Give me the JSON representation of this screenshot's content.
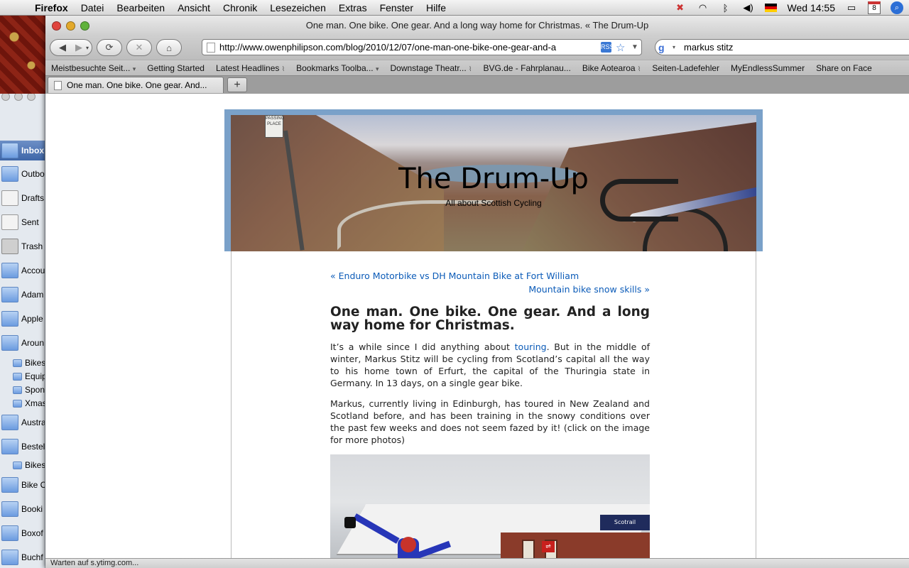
{
  "menubar": {
    "app": "Firefox",
    "items": [
      "Datei",
      "Bearbeiten",
      "Ansicht",
      "Chronik",
      "Lesezeichen",
      "Extras",
      "Fenster",
      "Hilfe"
    ],
    "clock": "Wed 14:55",
    "calendar_day": "8"
  },
  "mail": {
    "items": [
      "Inbox",
      "Outbo",
      "Drafts",
      "Sent",
      "Trash",
      "Accou",
      "Adam",
      "Apple",
      "Aroun",
      "Bikes",
      "Equip",
      "Spons",
      "Xmas",
      "Austra",
      "Bestel",
      "Bikest",
      "Bike C",
      "Booki",
      "Boxof",
      "Buchf"
    ]
  },
  "window": {
    "title": "One man. One bike. One gear. And a long way home for Christmas. « The Drum-Up"
  },
  "navbar": {
    "url": "http://www.owenphilipson.com/blog/2010/12/07/one-man-one-bike-one-gear-and-a",
    "search_value": "markus stitz",
    "rss": "RSS"
  },
  "bookmarks": [
    {
      "label": "Meistbesuchte Seit...",
      "suffix": "▾"
    },
    {
      "label": "Getting Started",
      "suffix": ""
    },
    {
      "label": "Latest Headlines",
      "suffix": "⌇"
    },
    {
      "label": "Bookmarks Toolba...",
      "suffix": "▾"
    },
    {
      "label": "Downstage Theatr...",
      "suffix": "⌇"
    },
    {
      "label": "BVG.de - Fahrplanau...",
      "suffix": ""
    },
    {
      "label": "Bike Aotearoa",
      "suffix": "⌇"
    },
    {
      "label": "Seiten-Ladefehler",
      "suffix": ""
    },
    {
      "label": "MyEndlessSummer",
      "suffix": ""
    },
    {
      "label": "Share on Face",
      "suffix": ""
    }
  ],
  "tab": {
    "label": "One man. One bike. One gear. And...",
    "new_tab": "+"
  },
  "blog": {
    "title": "The Drum-Up",
    "description": "All about Scottish Cycling",
    "header_sign": "PASSING PLACE",
    "prev_link": "« Enduro Motorbike vs DH Mountain Bike at Fort William",
    "next_link": "Mountain bike snow skills »",
    "post_title": "One man. One bike. One gear. And a long way home for Christmas.",
    "p1_before": "It’s a while since I did anything about ",
    "p1_link": "touring",
    "p1_after": ". But in the middle of winter, Markus Stitz will be cycling from Scotland’s capital all the way to his home town of Erfurt, the capital of the Thuringia state in Germany. In 13 days, on a single gear bike.",
    "p2": "Markus, currently living in Edinburgh, has toured in New Zealand and Scotland before, and has been training in the snowy conditions over the past few weeks and does not seem fazed by it! (click on the image for more photos)",
    "photo_sign": "Scotrail"
  },
  "status": "Warten auf s.ytimg.com..."
}
